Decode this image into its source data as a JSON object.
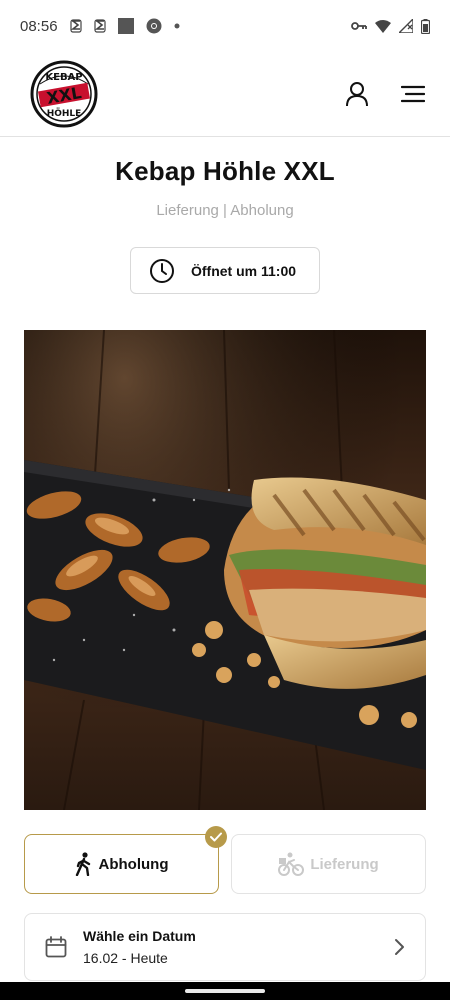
{
  "status_bar": {
    "time": "08:56",
    "left_icons": [
      "notification-s-icon",
      "notification-s-icon",
      "app-square-icon",
      "chrome-icon",
      "dot-icon"
    ],
    "right_icons": [
      "key-icon",
      "wifi-icon",
      "signal-icon",
      "battery-icon"
    ]
  },
  "header": {
    "logo_alt": "Kebap XXL Höhle logo",
    "actions": [
      "account-icon",
      "menu-icon"
    ]
  },
  "restaurant": {
    "name": "Kebap Höhle XXL",
    "services": "Lieferung | Abholung",
    "open_label": "Öffnet um 11:00"
  },
  "hero": {
    "description": "Kebab sandwich with potato wedges on slate board"
  },
  "order_mode": {
    "pickup_label": "Abholung",
    "delivery_label": "Lieferung",
    "selected": "pickup",
    "accent_color": "#b79a4a"
  },
  "date_picker": {
    "title": "Wähle ein Datum",
    "value": "16.02 - Heute"
  }
}
